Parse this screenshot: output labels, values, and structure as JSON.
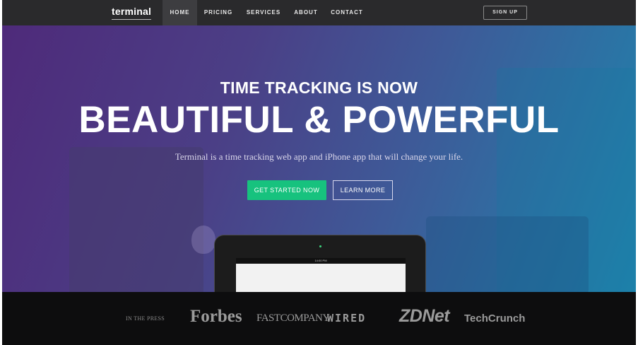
{
  "nav": {
    "logo": "terminal",
    "items": [
      {
        "label": "HOME",
        "active": true
      },
      {
        "label": "PRICING",
        "active": false
      },
      {
        "label": "SERVICES",
        "active": false
      },
      {
        "label": "ABOUT",
        "active": false
      },
      {
        "label": "CONTACT",
        "active": false
      }
    ],
    "signup": "SIGN UP"
  },
  "hero": {
    "kicker": "TIME TRACKING IS NOW",
    "headline": "BEAUTIFUL & POWERFUL",
    "subtitle": "Terminal is a time tracking web app and iPhone app that will change your life.",
    "primary_cta": "GET STARTED NOW",
    "secondary_cta": "LEARN MORE",
    "tablet_time": "14:00 PM"
  },
  "press": {
    "label": "IN THE PRESS",
    "logos": [
      "Forbes",
      "FASTCOMPANY",
      "WIRED",
      "ZDNet",
      "TechCrunch"
    ]
  },
  "colors": {
    "accent": "#17c27e",
    "nav_bg": "#2a2a2c",
    "press_bg": "#0d0d0e"
  }
}
